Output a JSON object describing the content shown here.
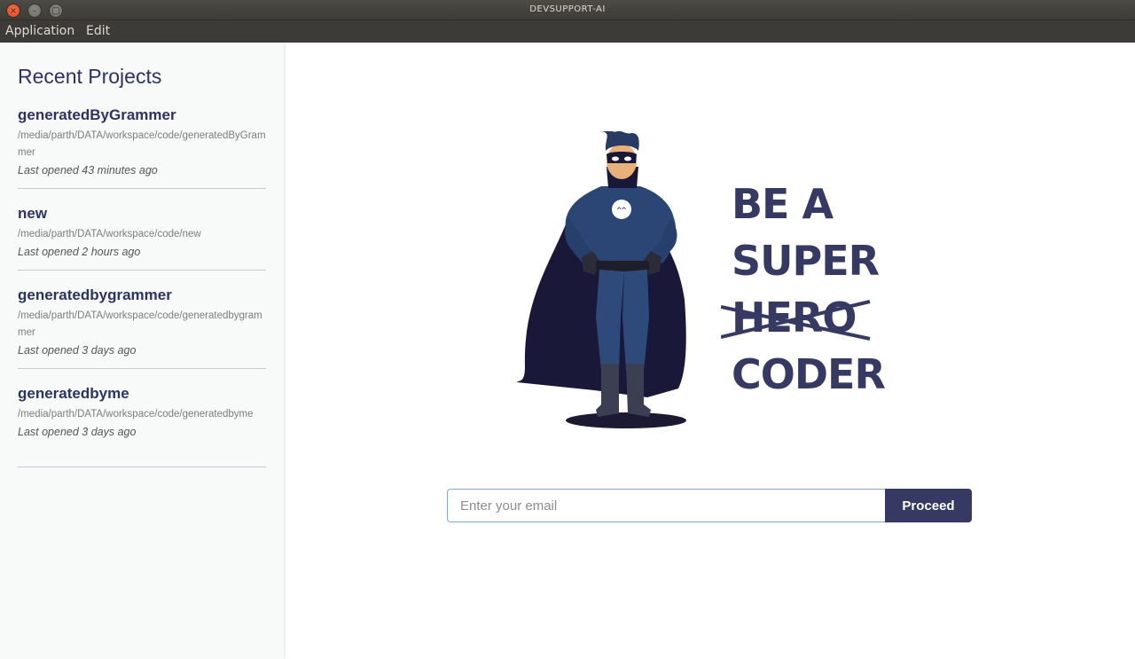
{
  "window": {
    "title": "DEVSUPPORT-AI",
    "close_glyph": "×",
    "min_glyph": "–",
    "max_glyph": "□"
  },
  "menu": {
    "items": [
      "Application",
      "Edit"
    ]
  },
  "sidebar": {
    "title": "Recent Projects",
    "projects": [
      {
        "name": "generatedByGrammer",
        "path": "/media/parth/DATA/workspace/code/generatedByGrammer",
        "opened": "Last opened 43 minutes ago"
      },
      {
        "name": "new",
        "path": "/media/parth/DATA/workspace/code/new",
        "opened": "Last opened 2 hours ago"
      },
      {
        "name": "generatedbygrammer",
        "path": "/media/parth/DATA/workspace/code/generatedbygrammer",
        "opened": "Last opened 3 days ago"
      },
      {
        "name": "generatedbyme",
        "path": "/media/parth/DATA/workspace/code/generatedbyme",
        "opened": "Last opened 3 days ago"
      }
    ]
  },
  "main": {
    "illustration": "superhero-illustration",
    "chest_emblem": "^^",
    "tagline": {
      "line1": "BE A",
      "line2": "SUPER",
      "struck": "HERO",
      "line4": "CODER"
    },
    "email": {
      "placeholder": "Enter your email",
      "value": ""
    },
    "proceed_label": "Proceed"
  },
  "colors": {
    "accent": "#363a63",
    "titlebar": "#3c3b37",
    "sidebar_bg": "#f8fafa"
  }
}
